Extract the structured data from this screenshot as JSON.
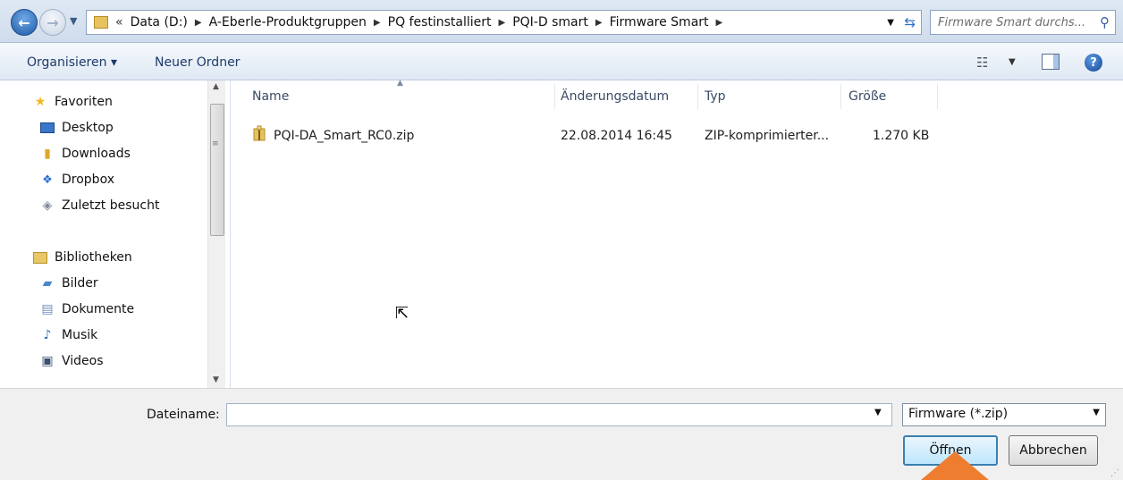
{
  "address_bar": {
    "path_prefix": "«",
    "crumbs": [
      "Data (D:)",
      "A-Eberle-Produktgruppen",
      "PQ festinstalliert",
      "PQI-D smart",
      "Firmware Smart"
    ],
    "search_placeholder": "Firmware Smart durchs..."
  },
  "toolbar": {
    "organize_label": "Organisieren ▾",
    "new_folder_label": "Neuer Ordner"
  },
  "nav_pane": {
    "favorites_label": "Favoriten",
    "favorites": [
      "Desktop",
      "Downloads",
      "Dropbox",
      "Zuletzt besucht"
    ],
    "libraries_label": "Bibliotheken",
    "libraries": [
      "Bilder",
      "Dokumente",
      "Musik",
      "Videos"
    ]
  },
  "file_list": {
    "columns": [
      "Name",
      "Änderungsdatum",
      "Typ",
      "Größe"
    ],
    "rows": [
      {
        "name": "PQI-DA_Smart_RC0.zip",
        "date": "22.08.2014 16:45",
        "type": "ZIP-komprimierter...",
        "size": "1.270 KB"
      }
    ]
  },
  "footer": {
    "filename_label": "Dateiname:",
    "filename_value": "",
    "filetype_value": "Firmware (*.zip)",
    "open_label": "Öffnen",
    "cancel_label": "Abbrechen"
  },
  "colors": {
    "highlight_arrow": "#ee7d2f",
    "accent": "#3c7fb1"
  }
}
